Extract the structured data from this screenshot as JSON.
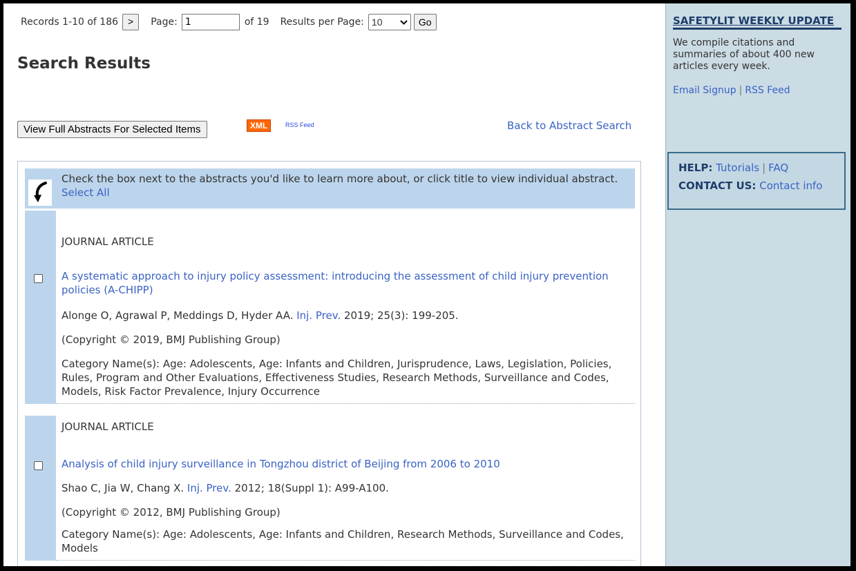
{
  "nav": {
    "records_label": "Records 1-10 of 186",
    "next_label": ">",
    "page_label": "Page:",
    "page_value": "1",
    "of_label": "of 19",
    "rpp_label": "Results per Page:",
    "rpp_value": "10",
    "go_label": "Go"
  },
  "page_title": "Search Results",
  "actions": {
    "view_full_label": "View Full Abstracts For Selected Items",
    "xml_label": "XML",
    "rss_label": "RSS Feed",
    "back_label": "Back to Abstract Search"
  },
  "instructions": {
    "text": "Check the box next to the abstracts you'd like to learn more about, or click title to view individual abstract.",
    "select_all": "Select All"
  },
  "records": [
    {
      "type": "JOURNAL ARTICLE",
      "title": "A systematic approach to injury policy assessment: introducing the assessment of child injury prevention policies (A-CHIPP)",
      "authors": "Alonge O, Agrawal P, Meddings D, Hyder AA.",
      "journal": "Inj. Prev.",
      "citation": "2019; 25(3): 199-205.",
      "copyright": "(Copyright © 2019, BMJ Publishing Group)",
      "categories": "Category Name(s): Age: Adolescents, Age: Infants and Children, Jurisprudence, Laws, Legislation, Policies, Rules, Program and Other Evaluations, Effectiveness Studies, Research Methods, Surveillance and Codes, Models, Risk Factor Prevalence, Injury Occurrence"
    },
    {
      "type": "JOURNAL ARTICLE",
      "title": "Analysis of child injury surveillance in Tongzhou district of Beijing from 2006 to 2010",
      "authors": "Shao C, Jia W, Chang X.",
      "journal": "Inj. Prev.",
      "citation": "2012; 18(Suppl 1): A99-A100.",
      "copyright": "(Copyright © 2012, BMJ Publishing Group)",
      "categories": "Category Name(s): Age: Adolescents, Age: Infants and Children, Research Methods, Surveillance and Codes, Models"
    }
  ],
  "sidebar": {
    "title": "SAFETYLIT WEEKLY UPDATE",
    "desc": "We compile citations and summaries of about 400 new articles every week.",
    "email_signup": "Email Signup",
    "sep": "|",
    "rss_feed": "RSS Feed",
    "help_label": "HELP:",
    "tutorials": "Tutorials",
    "faq": "FAQ",
    "contact_label": "CONTACT US:",
    "contact_info": "Contact info"
  },
  "colors": {
    "link": "#3a62c4",
    "highlight": "#bcd5ec",
    "sidebar_bg": "#cbdce4",
    "xml_badge": "#ff6600"
  }
}
